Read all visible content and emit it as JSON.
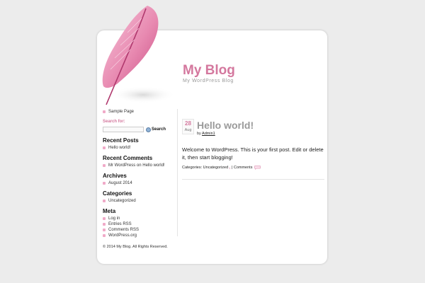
{
  "site": {
    "title": "My Blog",
    "description": "My WordPress Blog"
  },
  "colors": {
    "accent": "#d4789e",
    "bullet": "#f0aac8",
    "background": "#ececec"
  },
  "sidebar": {
    "pages": [
      "Sample Page"
    ],
    "search": {
      "label": "Search for:",
      "placeholder": "",
      "button": "Search"
    },
    "recent_posts": {
      "title": "Recent Posts",
      "items": [
        "Hello world!"
      ]
    },
    "recent_comments": {
      "title": "Recent Comments",
      "items": [
        "Mr WordPress on Hello world!"
      ]
    },
    "archives": {
      "title": "Archives",
      "items": [
        "August 2014"
      ]
    },
    "categories": {
      "title": "Categories",
      "items": [
        "Uncategorized"
      ]
    },
    "meta": {
      "title": "Meta",
      "items": [
        "Log in",
        "Entries RSS",
        "Comments RSS",
        "WordPress.org"
      ]
    }
  },
  "post": {
    "date_day": "28",
    "date_month": "Aug",
    "title": "Hello world!",
    "by_prefix": "by",
    "author": "Admin1",
    "body": "Welcome to WordPress. This is your first post. Edit or delete it, then start blogging!",
    "categories_label": "Categories:",
    "category": "Uncategorized",
    "category_count": "1",
    "comments_label": "| Comments",
    "comment_icon": "speech-bubble-icon"
  },
  "footer": {
    "text": "© 2014  My Blog.  All Rights Reserved."
  }
}
